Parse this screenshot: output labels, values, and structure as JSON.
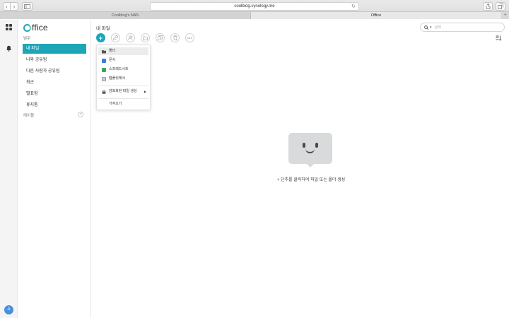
{
  "browser": {
    "url": "coolblog.synology.me",
    "tabs": [
      {
        "title": "Coolblog's NAS",
        "active": false
      },
      {
        "title": "Office",
        "active": true
      }
    ],
    "back_glyph": "‹",
    "forward_glyph": "›",
    "newtab_glyph": "+",
    "reload_glyph": "↻"
  },
  "app": {
    "logo_text": "ffice",
    "avatar_initial": "A",
    "accent_color": "#1ea6b8"
  },
  "leftnav": {
    "section_label": "범주",
    "items": [
      {
        "label": "내 파일",
        "active": true
      },
      {
        "label": "나와 공유됨",
        "active": false
      },
      {
        "label": "다른 사람과 공유됨",
        "active": false
      },
      {
        "label": "최근",
        "active": false
      },
      {
        "label": "별표함",
        "active": false
      },
      {
        "label": "휴지통",
        "active": false
      }
    ],
    "labels_heading": "레이블",
    "labels_add": "+"
  },
  "main": {
    "title": "내 파일",
    "search_placeholder": "검색",
    "toolbar": {
      "create_glyph": "+",
      "icons": [
        "link-icon",
        "share-user-icon",
        "move-folder-icon",
        "copy-icon",
        "delete-icon",
        "more-icon"
      ]
    },
    "empty_text": "+ 단추를 클릭하여 파일 또는 폴더 생성"
  },
  "dropdown": {
    "items": [
      {
        "label": "폴더",
        "icon": "folder-icon",
        "color": "#555555"
      },
      {
        "label": "문서",
        "icon": "document-icon",
        "color": "#3d7be0"
      },
      {
        "label": "스프레드시트",
        "icon": "spreadsheet-icon",
        "color": "#3aa757"
      },
      {
        "label": "템플릿에서",
        "icon": "template-icon",
        "color": "#777777"
      },
      {
        "label": "암호화된 파일 생성",
        "icon": "lock-icon",
        "color": "#555555"
      },
      {
        "label": "가져오기",
        "icon": "",
        "color": ""
      }
    ],
    "submenu_glyph": "▶"
  }
}
